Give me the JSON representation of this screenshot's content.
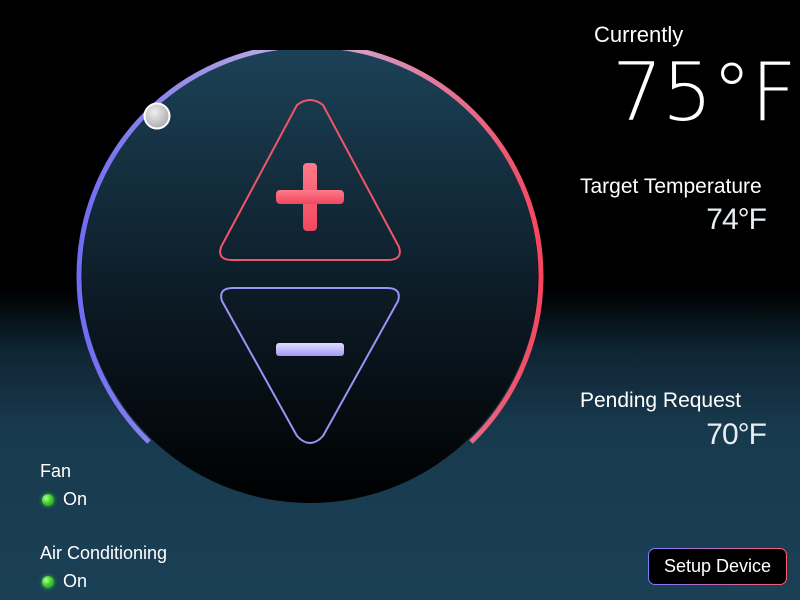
{
  "current": {
    "label": "Currently",
    "value": "75°F"
  },
  "target": {
    "label": "Target Temperature",
    "value": "74°F"
  },
  "pending": {
    "label": "Pending Request",
    "value": "70°F"
  },
  "status": {
    "fan": {
      "label": "Fan",
      "state": "On"
    },
    "ac": {
      "label": "Air Conditioning",
      "state": "On"
    }
  },
  "setup_button": {
    "label": "Setup Device"
  },
  "dial": {
    "increase_icon": "plus-icon",
    "decrease_icon": "minus-icon",
    "colors": {
      "cool": "#6f6cf2",
      "heat": "#f5475f",
      "increase": "#ff5d72",
      "decrease": "#9b93f5"
    }
  }
}
